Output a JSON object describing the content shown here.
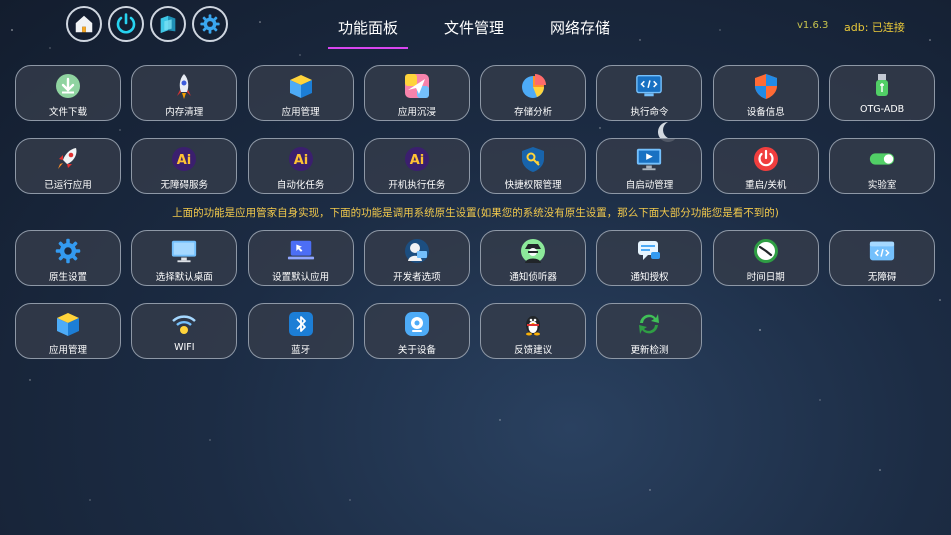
{
  "tabs": [
    {
      "label": "功能面板"
    },
    {
      "label": "文件管理"
    },
    {
      "label": "网络存储"
    }
  ],
  "version": "v1.6.3",
  "adb_status": "adb: 已连接",
  "notice": "上面的功能是应用管家自身实现，下面的功能是调用系统原生设置(如果您的系统没有原生设置，那么下面大部分功能您是看不到的)",
  "top_icons": [
    "home-icon",
    "power-icon",
    "layers-icon",
    "gear-icon"
  ],
  "row1": [
    {
      "label": "文件下载",
      "icon": "download-icon"
    },
    {
      "label": "内存清理",
      "icon": "rocket-icon"
    },
    {
      "label": "应用管理",
      "icon": "box-icon"
    },
    {
      "label": "应用沉浸",
      "icon": "immersion-icon"
    },
    {
      "label": "存储分析",
      "icon": "pie-chart-icon"
    },
    {
      "label": "执行命令",
      "icon": "terminal-icon"
    },
    {
      "label": "设备信息",
      "icon": "shield-icon"
    },
    {
      "label": "OTG-ADB",
      "icon": "usb-icon"
    }
  ],
  "row2": [
    {
      "label": "已运行应用",
      "icon": "rocket-launch-icon"
    },
    {
      "label": "无障碍服务",
      "icon": "ai-icon"
    },
    {
      "label": "自动化任务",
      "icon": "ai-icon"
    },
    {
      "label": "开机执行任务",
      "icon": "ai-icon"
    },
    {
      "label": "快捷权限管理",
      "icon": "key-shield-icon"
    },
    {
      "label": "自启动管理",
      "icon": "monitor-play-icon"
    },
    {
      "label": "重启/关机",
      "icon": "power-red-icon"
    },
    {
      "label": "实验室",
      "icon": "toggle-icon"
    }
  ],
  "row3": [
    {
      "label": "原生设置",
      "icon": "gear-icon"
    },
    {
      "label": "选择默认桌面",
      "icon": "desktop-icon"
    },
    {
      "label": "设置默认应用",
      "icon": "laptop-cursor-icon"
    },
    {
      "label": "开发者选项",
      "icon": "developer-icon"
    },
    {
      "label": "通知侦听器",
      "icon": "spy-icon"
    },
    {
      "label": "通知授权",
      "icon": "chat-icon"
    },
    {
      "label": "时间日期",
      "icon": "clock-icon"
    },
    {
      "label": "无障碍",
      "icon": "code-window-icon"
    }
  ],
  "row4": [
    {
      "label": "应用管理",
      "icon": "box-icon"
    },
    {
      "label": "WIFI",
      "icon": "wifi-icon"
    },
    {
      "label": "蓝牙",
      "icon": "bluetooth-icon"
    },
    {
      "label": "关于设备",
      "icon": "about-device-icon"
    },
    {
      "label": "反馈建议",
      "icon": "penguin-icon"
    },
    {
      "label": "更新检测",
      "icon": "refresh-icon"
    }
  ]
}
